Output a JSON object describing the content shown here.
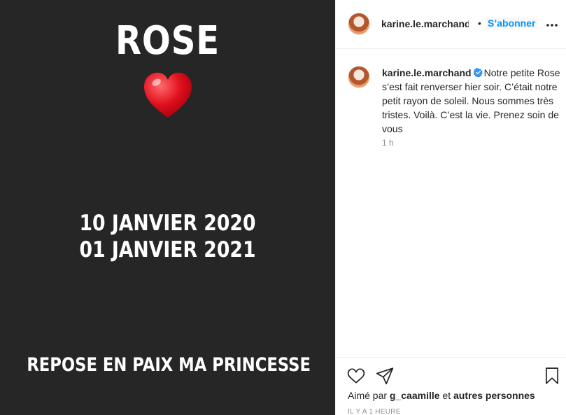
{
  "post_image": {
    "title": "ROSE",
    "heart_icon": "red-heart-emoji",
    "date_lines": [
      "10 JANVIER 2020",
      "01 JANVIER 2021"
    ],
    "footer_text": "REPOSE EN PAIX MA PRINCESSE"
  },
  "header": {
    "username": "karine.le.marchand",
    "separator": "•",
    "follow_label": "S’abonner",
    "more_icon": "more-horizontal-icon"
  },
  "caption": {
    "username": "karine.le.marchand",
    "verified_icon": "verified-badge-icon",
    "text": "Notre petite Rose s’est fait renverser hier soir. C’était notre petit rayon de soleil. Nous sommes très tristes. Voilà. C’est la vie. Prenez soin de vous",
    "time": "1 h"
  },
  "actions": {
    "icons": [
      "heart-outline-icon",
      "paper-plane-icon",
      "bookmark-icon"
    ],
    "liked_prefix": "Aimé par",
    "liked_user": "g_caamille",
    "liked_and": "et",
    "liked_others": "autres personnes",
    "time_ago": "IL Y A 1 HEURE"
  },
  "colors": {
    "image_background": "#262626",
    "accent": "#0095f6",
    "verified": "#3897f0",
    "secondary_text": "#8e8e8e"
  }
}
